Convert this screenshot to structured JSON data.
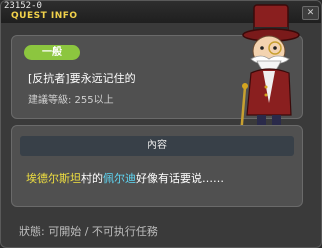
{
  "window": {
    "quest_id": "23152-0",
    "title": "QUEST INFO",
    "close_label": "✕"
  },
  "quest": {
    "badge": "一般",
    "name": "[反抗者]要永远记住的",
    "level": "建議等級: 255以上"
  },
  "content": {
    "header": "內容",
    "npc_name": "埃德尔斯坦",
    "text_mid": "村的",
    "npc2_name": "佩尔迪",
    "text_end": "好像有话要说……"
  },
  "status": {
    "text": "狀態: 可開始 / 不可执行任務"
  },
  "icons": {
    "npc": "old-gentleman-top-hat-npc-icon"
  },
  "colors": {
    "title": "#f2d24b",
    "badge": "#8cc63f",
    "highlight_yellow": "#f0e040",
    "highlight_cyan": "#5fd7f5"
  }
}
